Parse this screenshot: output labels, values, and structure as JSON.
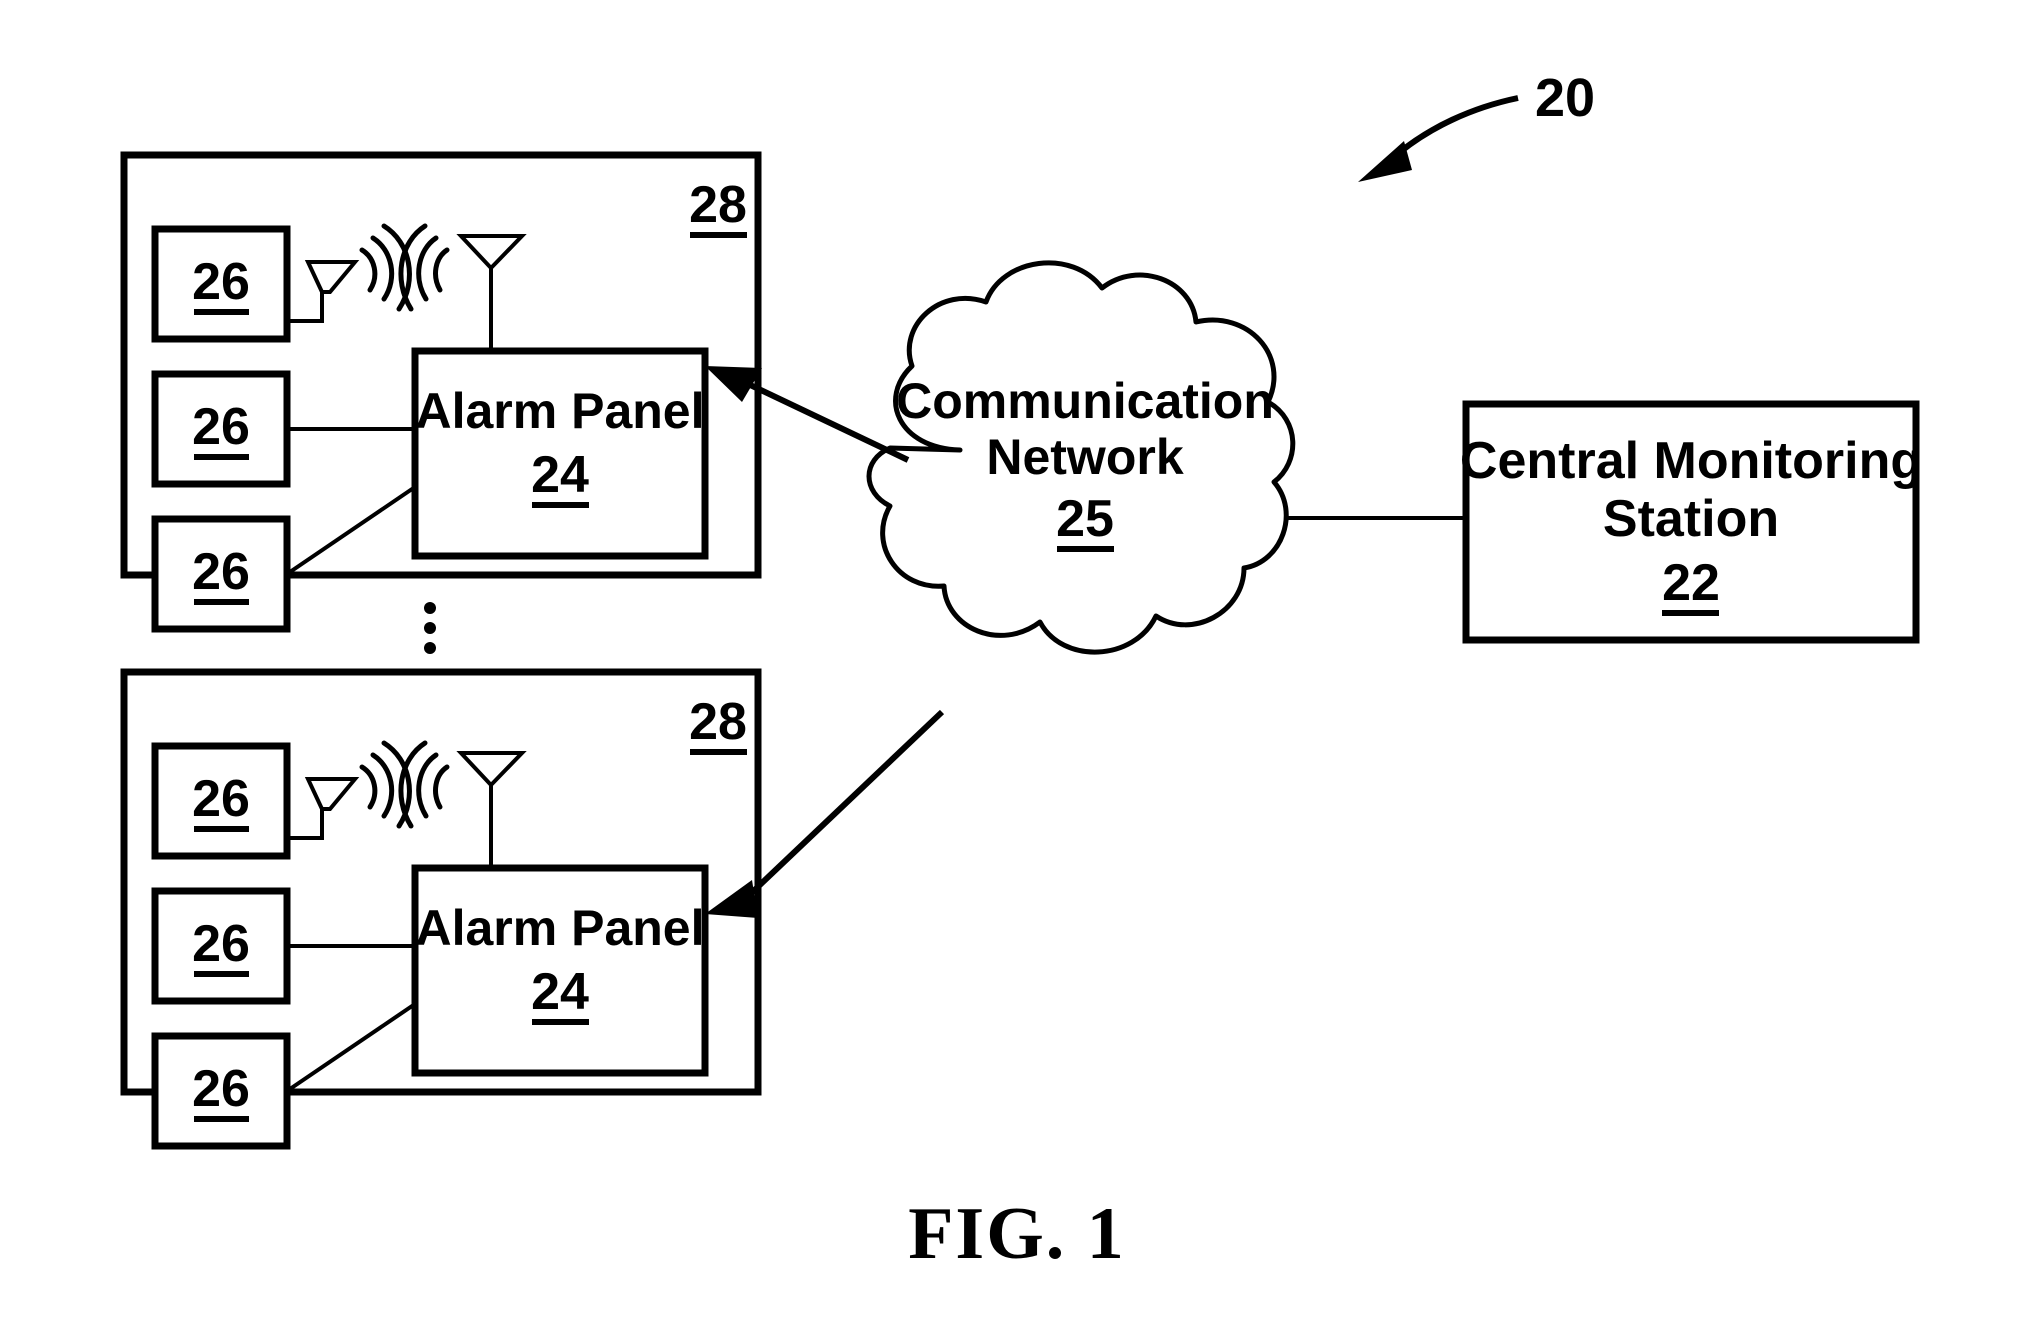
{
  "figure": {
    "caption": "FIG. 1",
    "system_ref": "20"
  },
  "central_station": {
    "line1": "Central Monitoring",
    "line2": "Station",
    "ref": "22"
  },
  "network": {
    "line1": "Communication",
    "line2": "Network",
    "ref": "25"
  },
  "premises": [
    {
      "ref": "28",
      "panel": {
        "label": "Alarm Panel",
        "ref": "24"
      },
      "sensors": [
        {
          "ref": "26",
          "link": "wireless"
        },
        {
          "ref": "26",
          "link": "wired-straight"
        },
        {
          "ref": "26",
          "link": "wired-diagonal"
        }
      ]
    },
    {
      "ref": "28",
      "panel": {
        "label": "Alarm Panel",
        "ref": "24"
      },
      "sensors": [
        {
          "ref": "26",
          "link": "wireless"
        },
        {
          "ref": "26",
          "link": "wired-straight"
        },
        {
          "ref": "26",
          "link": "wired-diagonal"
        }
      ]
    }
  ],
  "icons": {
    "antenna": "antenna-icon",
    "radio_waves": "radio-waves-icon",
    "vertical_ellipsis": "vertical-ellipsis-icon",
    "arrow": "arrow-icon",
    "cloud": "cloud-icon"
  },
  "colors": {
    "ink": "#000000",
    "paper": "#ffffff"
  }
}
